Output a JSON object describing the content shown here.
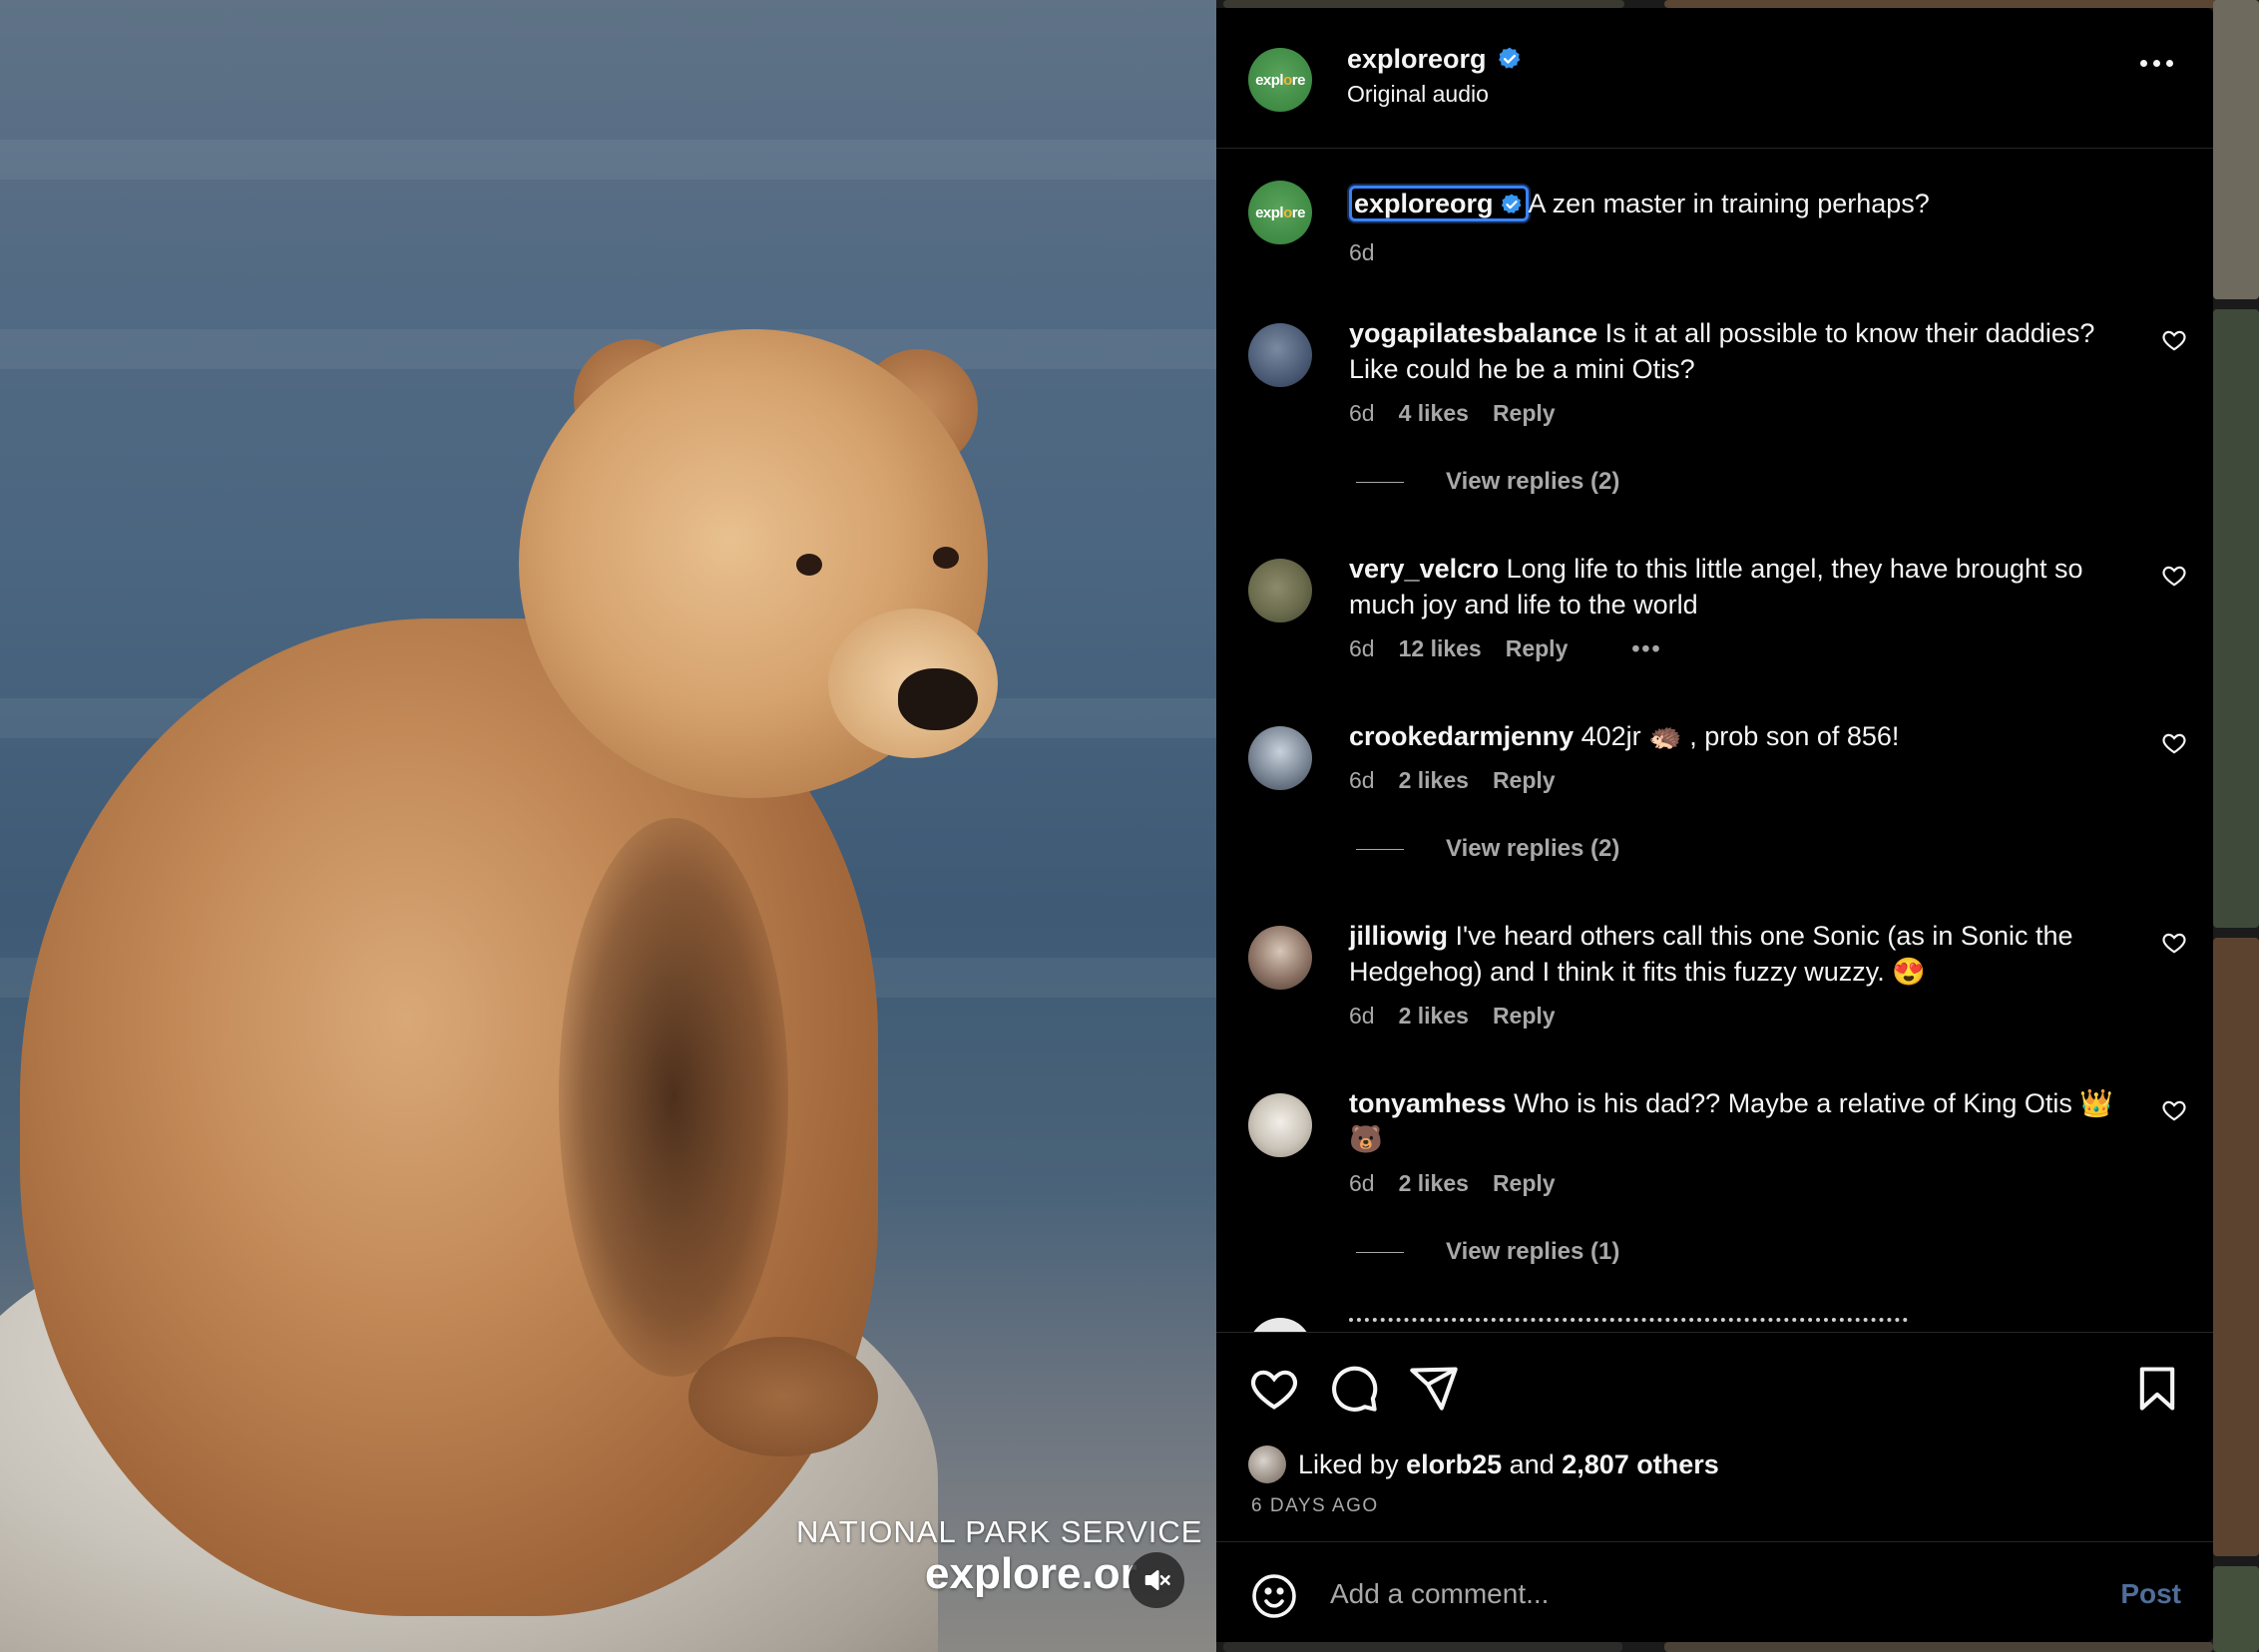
{
  "post": {
    "username": "exploreorg",
    "audio_label": "Original audio",
    "avatar_text_1": "expl",
    "avatar_text_2": "o",
    "avatar_text_3": "re"
  },
  "media": {
    "watermark_1": "NATIONAL PARK SERVICE",
    "watermark_2": "explore.or",
    "sound": "muted"
  },
  "caption": {
    "username": "exploreorg",
    "text": "A zen master in training perhaps?",
    "time": "6d"
  },
  "comments": [
    {
      "username": "yogapilatesbalance",
      "text": "Is it at all possible to know their daddies? Like could he be a mini Otis?",
      "time": "6d",
      "likes": "4 likes",
      "reply": "Reply",
      "view_replies": "View replies (2)"
    },
    {
      "username": "very_velcro",
      "text": "Long life to this little angel, they have brought so much joy and life to the world",
      "time": "6d",
      "likes": "12 likes",
      "reply": "Reply"
    },
    {
      "username": "crookedarmjenny",
      "text": "402jr 🦔 , prob son of 856!",
      "time": "6d",
      "likes": "2 likes",
      "reply": "Reply",
      "view_replies": "View replies (2)"
    },
    {
      "username": "jilliowig",
      "text": "I've heard others call this one Sonic (as in Sonic the Hedgehog) and I think it fits this fuzzy wuzzy. 😍",
      "time": "6d",
      "likes": "2 likes",
      "reply": "Reply"
    },
    {
      "username": "tonyamhess",
      "text": "Who is his dad?? Maybe a relative of King Otis 👑 🐻",
      "time": "6d",
      "likes": "2 likes",
      "reply": "Reply",
      "view_replies": "View replies (1)"
    }
  ],
  "likes": {
    "prefix": "Liked by",
    "user": "elorb25",
    "joiner": "and",
    "others": "2,807 others",
    "date": "6 DAYS AGO"
  },
  "add_comment": {
    "placeholder": "Add a comment...",
    "post_label": "Post"
  },
  "colors": {
    "accent_blue": "#3b82f6",
    "post_button": "#4f6e9a",
    "verified": "#3897f0",
    "muted_text": "#a8a8a8"
  }
}
